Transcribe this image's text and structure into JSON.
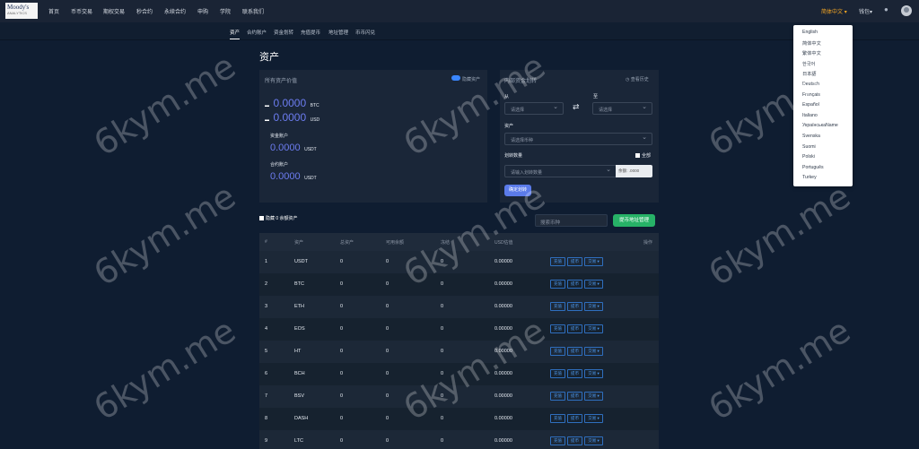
{
  "logo": {
    "brand": "Moody's",
    "sub": "ANALYTICS"
  },
  "nav": [
    "首页",
    "币币交易",
    "期权交易",
    "秒合约",
    "永续合约",
    "申购",
    "学院",
    "联系我们"
  ],
  "header": {
    "language": "简体中文",
    "wallet": "钱包"
  },
  "subnav": [
    "资产",
    "合约账户",
    "资金划转",
    "充值提币",
    "地址管理",
    "币币闪兑"
  ],
  "page_title": "资产",
  "assets": {
    "title": "所有资产价值",
    "toggle_label": "隐藏资产",
    "btc_value": "0.0000",
    "btc_unit": "BTC",
    "usd_value": "0.0000",
    "usd_unit": "USD",
    "fund_account_label": "资金账户",
    "fund_value": "0.0000",
    "fund_unit": "USDT",
    "contract_account_label": "合约账户",
    "contract_value": "0.0000",
    "contract_unit": "USDT"
  },
  "transfer": {
    "title": "内部资金划转",
    "history": "查看历史",
    "from_label": "从",
    "to_label": "至",
    "from_placeholder": "请选择",
    "to_placeholder": "请选择",
    "asset_label": "资产",
    "asset_placeholder": "请选择币种",
    "amount_label": "划转数量",
    "all_label": "全部",
    "amount_placeholder": "请输入划转数量",
    "balance": "余额: .0000",
    "confirm": "确定划转"
  },
  "filters": {
    "hide_zero": "隐藏 0 余额资产",
    "search_placeholder": "搜索币种",
    "manage_btn": "提币地址管理"
  },
  "table": {
    "headers": [
      "#",
      "资产",
      "总资产",
      "可用余额",
      "冻结",
      "USD估值",
      "操作"
    ],
    "rows": [
      {
        "no": "1",
        "asset": "USDT",
        "total": "0",
        "avail": "0",
        "frozen": "0",
        "usd": "0.00000"
      },
      {
        "no": "2",
        "asset": "BTC",
        "total": "0",
        "avail": "0",
        "frozen": "0",
        "usd": "0.00000"
      },
      {
        "no": "3",
        "asset": "ETH",
        "total": "0",
        "avail": "0",
        "frozen": "0",
        "usd": "0.00000"
      },
      {
        "no": "4",
        "asset": "EOS",
        "total": "0",
        "avail": "0",
        "frozen": "0",
        "usd": "0.00000"
      },
      {
        "no": "5",
        "asset": "HT",
        "total": "0",
        "avail": "0",
        "frozen": "0",
        "usd": "0.00000"
      },
      {
        "no": "6",
        "asset": "BCH",
        "total": "0",
        "avail": "0",
        "frozen": "0",
        "usd": "0.00000"
      },
      {
        "no": "7",
        "asset": "BSV",
        "total": "0",
        "avail": "0",
        "frozen": "0",
        "usd": "0.00000"
      },
      {
        "no": "8",
        "asset": "DASH",
        "total": "0",
        "avail": "0",
        "frozen": "0",
        "usd": "0.00000"
      },
      {
        "no": "9",
        "asset": "LTC",
        "total": "0",
        "avail": "0",
        "frozen": "0",
        "usd": "0.00000"
      }
    ],
    "actions": [
      "充值",
      "提币",
      "交易"
    ]
  },
  "languages": [
    "English",
    "简体中文",
    "繁体中文",
    "한국어",
    "日本語",
    "Deutsch",
    "Français",
    "Español",
    "Italiano",
    "УкраїнськаName",
    "Svenska",
    "Suomi",
    "Polski",
    "Português",
    "Turkey"
  ],
  "watermark": "6kym.me",
  "colors": {
    "accent": "#6c7cf0",
    "primary_btn": "#5b7bea",
    "green_btn": "#27b267",
    "lang_active": "#f5a623"
  }
}
